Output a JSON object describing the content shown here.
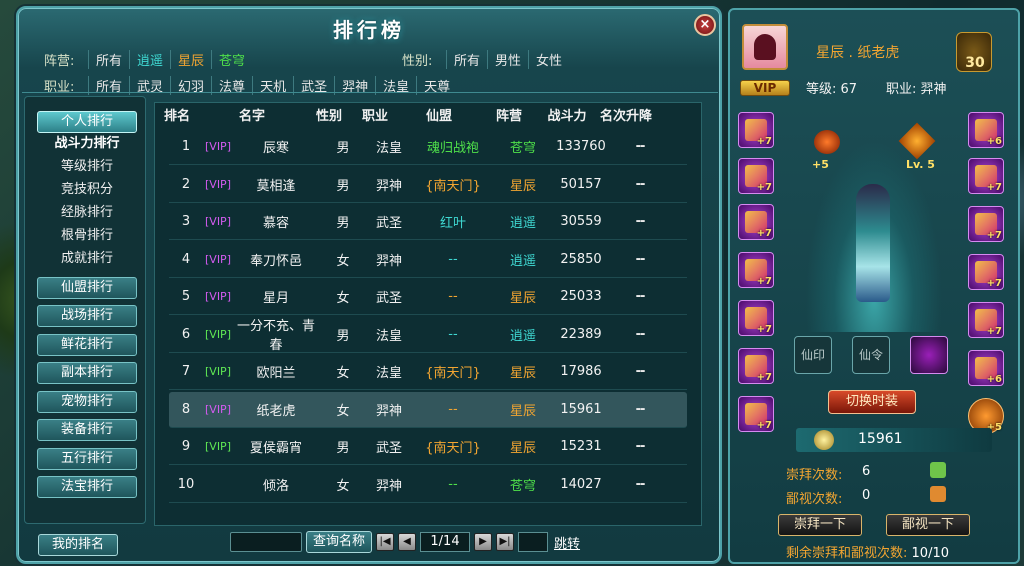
{
  "window": {
    "title": "排行榜",
    "close_label": "×"
  },
  "filters": {
    "camp_label": "阵营:",
    "camps": [
      {
        "label": "所有",
        "color": "white"
      },
      {
        "label": "逍遥",
        "color": "cyan"
      },
      {
        "label": "星辰",
        "color": "orange"
      },
      {
        "label": "苍穹",
        "color": "green"
      }
    ],
    "sex_label": "性别:",
    "sexes": [
      "所有",
      "男性",
      "女性"
    ],
    "job_label": "职业:",
    "jobs": [
      "所有",
      "武灵",
      "幻羽",
      "法尊",
      "天机",
      "武圣",
      "羿神",
      "法皇",
      "天尊"
    ]
  },
  "sidebar": {
    "personal": "个人排行",
    "sub_items": [
      "战斗力排行",
      "等级排行",
      "竞技积分",
      "经脉排行",
      "根骨排行",
      "成就排行"
    ],
    "sections": [
      "仙盟排行",
      "战场排行",
      "鲜花排行",
      "副本排行",
      "宠物排行",
      "装备排行",
      "五行排行",
      "法宝排行"
    ],
    "my_rank": "我的排名"
  },
  "table": {
    "headers": [
      "排名",
      "名字",
      "性别",
      "职业",
      "仙盟",
      "阵营",
      "战斗力",
      "名次升降"
    ],
    "rows": [
      {
        "rank": "1",
        "vip": "[VIP]",
        "vip_color": "vipp",
        "name": "辰寒",
        "sex": "男",
        "job": "法皇",
        "guild": "魂归战袍",
        "guild_color": "green",
        "camp": "苍穹",
        "camp_color": "green",
        "power": "133760",
        "change": "--"
      },
      {
        "rank": "2",
        "vip": "[VIP]",
        "vip_color": "vipp",
        "name": "莫相逢",
        "sex": "男",
        "job": "羿神",
        "guild": "{南天门}",
        "guild_color": "orange",
        "camp": "星辰",
        "camp_color": "orange",
        "power": "50157",
        "change": "--"
      },
      {
        "rank": "3",
        "vip": "[VIP]",
        "vip_color": "vipp",
        "name": "慕容",
        "sex": "男",
        "job": "武圣",
        "guild": "红叶",
        "guild_color": "cyan",
        "camp": "逍遥",
        "camp_color": "cyan",
        "power": "30559",
        "change": "--"
      },
      {
        "rank": "4",
        "vip": "[VIP]",
        "vip_color": "vipp",
        "name": "奉刀怀邑",
        "sex": "女",
        "job": "羿神",
        "guild": "--",
        "guild_color": "cyan",
        "camp": "逍遥",
        "camp_color": "cyan",
        "power": "25850",
        "change": "--"
      },
      {
        "rank": "5",
        "vip": "[VIP]",
        "vip_color": "vipp",
        "name": "星月",
        "sex": "女",
        "job": "武圣",
        "guild": "--",
        "guild_color": "orange",
        "camp": "星辰",
        "camp_color": "orange",
        "power": "25033",
        "change": "--"
      },
      {
        "rank": "6",
        "vip": "[VIP]",
        "vip_color": "vipg",
        "name": "一分不充、青春",
        "sex": "男",
        "job": "法皇",
        "guild": "--",
        "guild_color": "cyan",
        "camp": "逍遥",
        "camp_color": "cyan",
        "power": "22389",
        "change": "--"
      },
      {
        "rank": "7",
        "vip": "[VIP]",
        "vip_color": "vipg",
        "name": "欧阳兰",
        "sex": "女",
        "job": "法皇",
        "guild": "{南天门}",
        "guild_color": "orange",
        "camp": "星辰",
        "camp_color": "orange",
        "power": "17986",
        "change": "--"
      },
      {
        "rank": "8",
        "vip": "[VIP]",
        "vip_color": "vipp",
        "name": "纸老虎",
        "sex": "女",
        "job": "羿神",
        "guild": "--",
        "guild_color": "orange",
        "camp": "星辰",
        "camp_color": "orange",
        "power": "15961",
        "change": "--"
      },
      {
        "rank": "9",
        "vip": "[VIP]",
        "vip_color": "vipg",
        "name": "夏侯霸宵",
        "sex": "男",
        "job": "武圣",
        "guild": "{南天门}",
        "guild_color": "orange",
        "camp": "星辰",
        "camp_color": "orange",
        "power": "15231",
        "change": "--"
      },
      {
        "rank": "10",
        "vip": "",
        "vip_color": "vipp",
        "name": "倾洛",
        "sex": "女",
        "job": "羿神",
        "guild": "--",
        "guild_color": "green",
        "camp": "苍穹",
        "camp_color": "green",
        "power": "14027",
        "change": "--"
      }
    ]
  },
  "pager": {
    "query_label": "查询名称",
    "page": "1/14",
    "jump_label": "跳转",
    "first": "|◀",
    "prev": "◀",
    "next": "▶",
    "last": "▶|"
  },
  "profile": {
    "name": "星辰 . 纸老虎",
    "vip": "VIP",
    "level": "等级: 67",
    "job": "职业: 羿神",
    "badge_level": "30",
    "enhance_left": "+5",
    "enhance_right": "Lv. 5",
    "slot_plus_left": [
      "+7",
      "+7",
      "+7",
      "+7",
      "+7",
      "+7",
      "+7"
    ],
    "slot_plus_right": [
      "+6",
      "+7",
      "+7",
      "+7",
      "+7",
      "+6",
      "+5"
    ],
    "btn_xianyin": "仙印",
    "btn_xianling": "仙令",
    "switch_label": "切换时装",
    "power": "15961",
    "worship_label": "崇拜次数:",
    "worship_value": "6",
    "despise_label": "鄙视次数:",
    "despise_value": "0",
    "worship_btn": "崇拜一下",
    "despise_btn": "鄙视一下",
    "remain_label": "剩余崇拜和鄙视次数:",
    "remain_value": "10/10"
  }
}
